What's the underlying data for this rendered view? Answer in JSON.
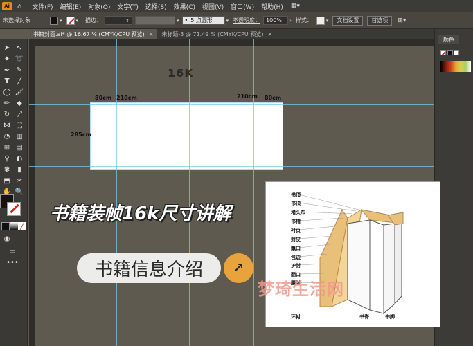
{
  "menubar": {
    "logo": "Ai",
    "items": [
      "文件(F)",
      "编辑(E)",
      "对象(O)",
      "文字(T)",
      "选择(S)",
      "效果(C)",
      "视图(V)",
      "窗口(W)",
      "帮助(H)"
    ]
  },
  "control": {
    "no_selection": "未选择对象",
    "stroke_label": "描边：",
    "stroke_value": "",
    "brush_value": "5 点圆形",
    "opacity_label": "不透明度：",
    "opacity_value": "100%",
    "style_label": "样式：",
    "doc_setup": "文档设置",
    "preferences": "首选项"
  },
  "tabs": [
    {
      "label": "书籍封面.ai* @ 16.67 % (CMYK/CPU 预览)",
      "close": "×"
    },
    {
      "label": "未标题-3 @ 71.49 % (CMYK/CPU 预览)",
      "close": "×"
    }
  ],
  "panel": {
    "title": "颜色"
  },
  "canvas": {
    "size_heading": "16K",
    "dim_80cm_left": "80cm",
    "dim_210cm_left": "210cm",
    "dim_210cm_right": "210cm",
    "dim_80cm_right": "80cm",
    "dim_285cm": "285cm"
  },
  "overlay": {
    "title": "书籍装帧16k尺寸讲解",
    "pill_text": "书籍信息介绍",
    "arrow": "↗"
  },
  "diagram": {
    "labels": [
      "书顶",
      "书顶",
      "堵头布",
      "书槽",
      "衬页",
      "封皮",
      "飘口",
      "包边",
      "护封",
      "翻口",
      "腰封",
      "环衬",
      "书脊",
      "书脚"
    ]
  },
  "watermark": "梦琦生活网",
  "colors": {
    "accent": "#e9a33c",
    "guide": "#76c9e6",
    "canvas": "#5f5a50"
  }
}
